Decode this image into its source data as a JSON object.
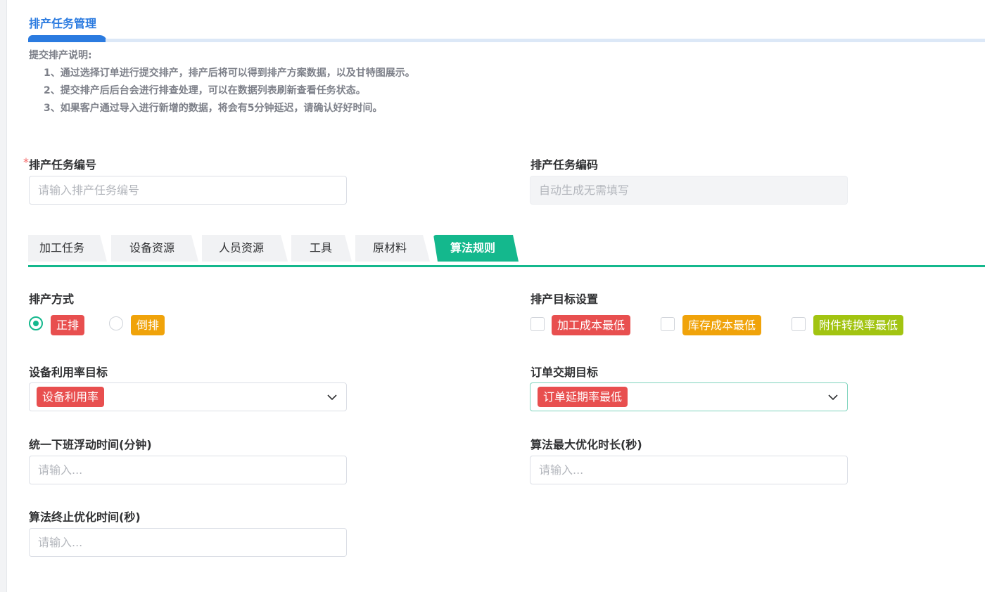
{
  "header": {
    "title": "排产任务管理"
  },
  "notes": {
    "title": "提交排产说明:",
    "lines": [
      "1、通过选择订单进行提交排产，排产后将可以得到排产方案数据，以及甘特图展示。",
      "2、提交排产后后台会进行排查处理，可以在数据列表刷新查看任务状态。",
      "3、如果客户通过导入进行新增的数据，将会有5分钟延迟，请确认好好时间。"
    ]
  },
  "form": {
    "task_no": {
      "required_mark": "*",
      "label": "排产任务编号",
      "placeholder": "请输入排产任务编号"
    },
    "task_code": {
      "label": "排产任务编码",
      "placeholder": "自动生成无需填写"
    }
  },
  "tabs": [
    "加工任务",
    "设备资源",
    "人员资源",
    "工具",
    "原材料",
    "算法规则"
  ],
  "active_tab": "算法规则",
  "rules": {
    "method": {
      "label": "排产方式",
      "options": [
        {
          "label": "正排",
          "checked": true,
          "color": "#e84f4f"
        },
        {
          "label": "倒排",
          "checked": false,
          "color": "#f0a30a"
        }
      ]
    },
    "target": {
      "label": "排产目标设置",
      "options": [
        {
          "label": "加工成本最低",
          "checked": false,
          "color": "#e84f4f"
        },
        {
          "label": "库存成本最低",
          "checked": false,
          "color": "#f0a30a"
        },
        {
          "label": "附件转换率最低",
          "checked": false,
          "color": "#a2c411"
        }
      ]
    },
    "utilization": {
      "label": "设备利用率目标",
      "value": "设备利用率",
      "color": "#e84f4f"
    },
    "delivery": {
      "label": "订单交期目标",
      "value": "订单延期率最低",
      "color": "#e84f4f"
    },
    "float_time": {
      "label": "统一下班浮动时间(分钟)",
      "placeholder": "请输入..."
    },
    "max_opt": {
      "label": "算法最大优化时长(秒)",
      "placeholder": "请输入..."
    },
    "stop_opt": {
      "label": "算法终止优化时间(秒)",
      "placeholder": "请输入..."
    }
  },
  "colors": {
    "primary": "#2b7be0",
    "accent": "#14b88d"
  }
}
